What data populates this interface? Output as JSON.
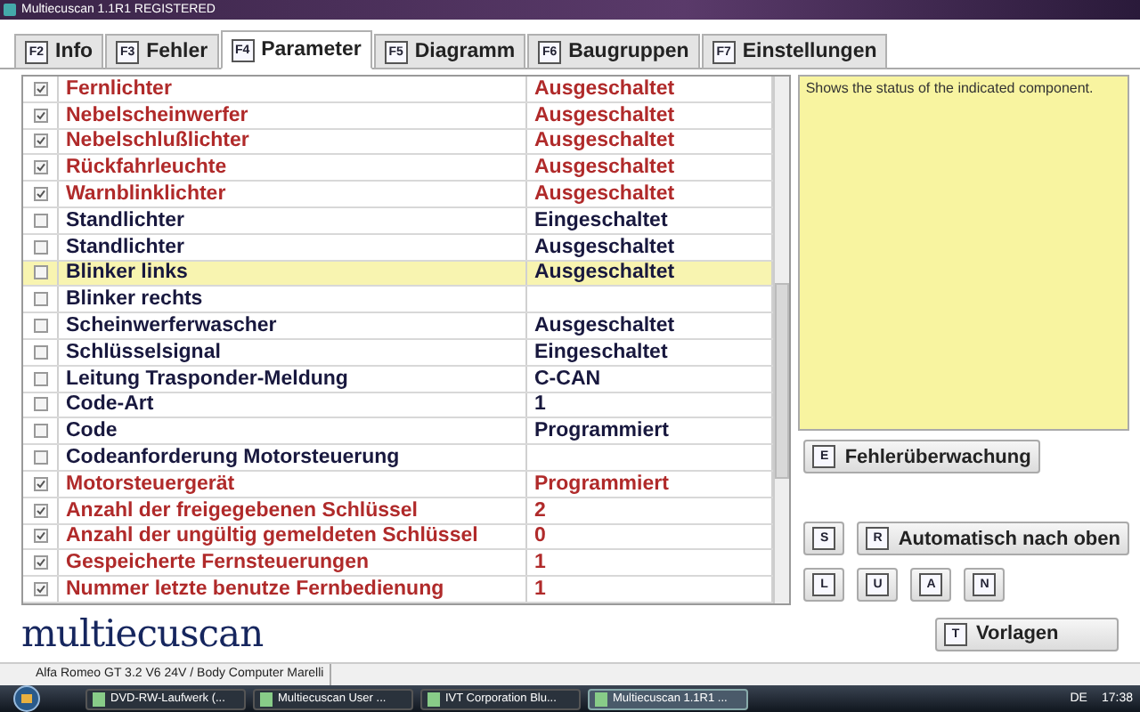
{
  "window": {
    "title": "Multiecuscan 1.1R1 REGISTERED"
  },
  "tabs": [
    {
      "key": "F2",
      "label": "Info",
      "selected": false
    },
    {
      "key": "F3",
      "label": "Fehler",
      "selected": false
    },
    {
      "key": "F4",
      "label": "Parameter",
      "selected": true
    },
    {
      "key": "F5",
      "label": "Diagramm",
      "selected": false
    },
    {
      "key": "F6",
      "label": "Baugruppen",
      "selected": false
    },
    {
      "key": "F7",
      "label": "Einstellungen",
      "selected": false
    }
  ],
  "parameters": [
    {
      "checked": true,
      "name": "Fernlichter",
      "value": "Ausgeschaltet",
      "selected": false
    },
    {
      "checked": true,
      "name": "Nebelscheinwerfer",
      "value": "Ausgeschaltet",
      "selected": false
    },
    {
      "checked": true,
      "name": "Nebelschlußlichter",
      "value": "Ausgeschaltet",
      "selected": false
    },
    {
      "checked": true,
      "name": "Rückfahrleuchte",
      "value": "Ausgeschaltet",
      "selected": false
    },
    {
      "checked": true,
      "name": "Warnblinklichter",
      "value": "Ausgeschaltet",
      "selected": false
    },
    {
      "checked": false,
      "name": "Standlichter",
      "value": "Eingeschaltet",
      "selected": false
    },
    {
      "checked": false,
      "name": "Standlichter",
      "value": "Ausgeschaltet",
      "selected": false
    },
    {
      "checked": false,
      "name": "Blinker links",
      "value": "Ausgeschaltet",
      "selected": true
    },
    {
      "checked": false,
      "name": "Blinker rechts",
      "selected": false
    },
    {
      "checked": false,
      "name": "Scheinwerferwascher",
      "value": "Ausgeschaltet",
      "selected": false
    },
    {
      "checked": false,
      "name": "Schlüsselsignal",
      "value": "Eingeschaltet",
      "selected": false
    },
    {
      "checked": false,
      "name": "Leitung Trasponder-Meldung",
      "value": "C-CAN",
      "selected": false
    },
    {
      "checked": false,
      "name": "Code-Art",
      "value": "1",
      "selected": false
    },
    {
      "checked": false,
      "name": "Code",
      "value": "Programmiert",
      "selected": false
    },
    {
      "checked": false,
      "name": "Codeanforderung Motorsteuerung",
      "selected": false
    },
    {
      "checked": true,
      "name": "Motorsteuergerät",
      "value": "Programmiert",
      "selected": false
    },
    {
      "checked": true,
      "name": "Anzahl der freigegebenen Schlüssel",
      "value": "2",
      "selected": false
    },
    {
      "checked": true,
      "name": "Anzahl der ungültig gemeldeten Schlüssel",
      "value": "0",
      "selected": false
    },
    {
      "checked": true,
      "name": "Gespeicherte Fernsteuerungen",
      "value": "1",
      "selected": false
    },
    {
      "checked": true,
      "name": "Nummer letzte benutze Fernbedienung",
      "value": "1",
      "selected": false
    }
  ],
  "description": "Shows the status of the indicated component.",
  "fault_button": {
    "key": "E",
    "label": "Fehlerüberwachung"
  },
  "stop_button": {
    "key": "S"
  },
  "auto_button": {
    "key": "R",
    "label": "Automatisch nach oben"
  },
  "small_buttons": [
    {
      "key": "L"
    },
    {
      "key": "U"
    },
    {
      "key": "A"
    },
    {
      "key": "N"
    }
  ],
  "logo": "multiecuscan",
  "templates_button": {
    "key": "T",
    "label": "Vorlagen"
  },
  "status_bar": {
    "vehicle": "Alfa Romeo GT 3.2 V6 24V / Body Computer Marelli"
  },
  "taskbar": {
    "tasks": [
      {
        "label": "DVD-RW-Laufwerk (...",
        "selected": false
      },
      {
        "label": "Multiecuscan User ...",
        "selected": false
      },
      {
        "label": "IVT Corporation Blu...",
        "selected": false
      },
      {
        "label": "Multiecuscan 1.1R1 ...",
        "selected": true
      }
    ],
    "language": "DE",
    "clock": "17:38"
  }
}
